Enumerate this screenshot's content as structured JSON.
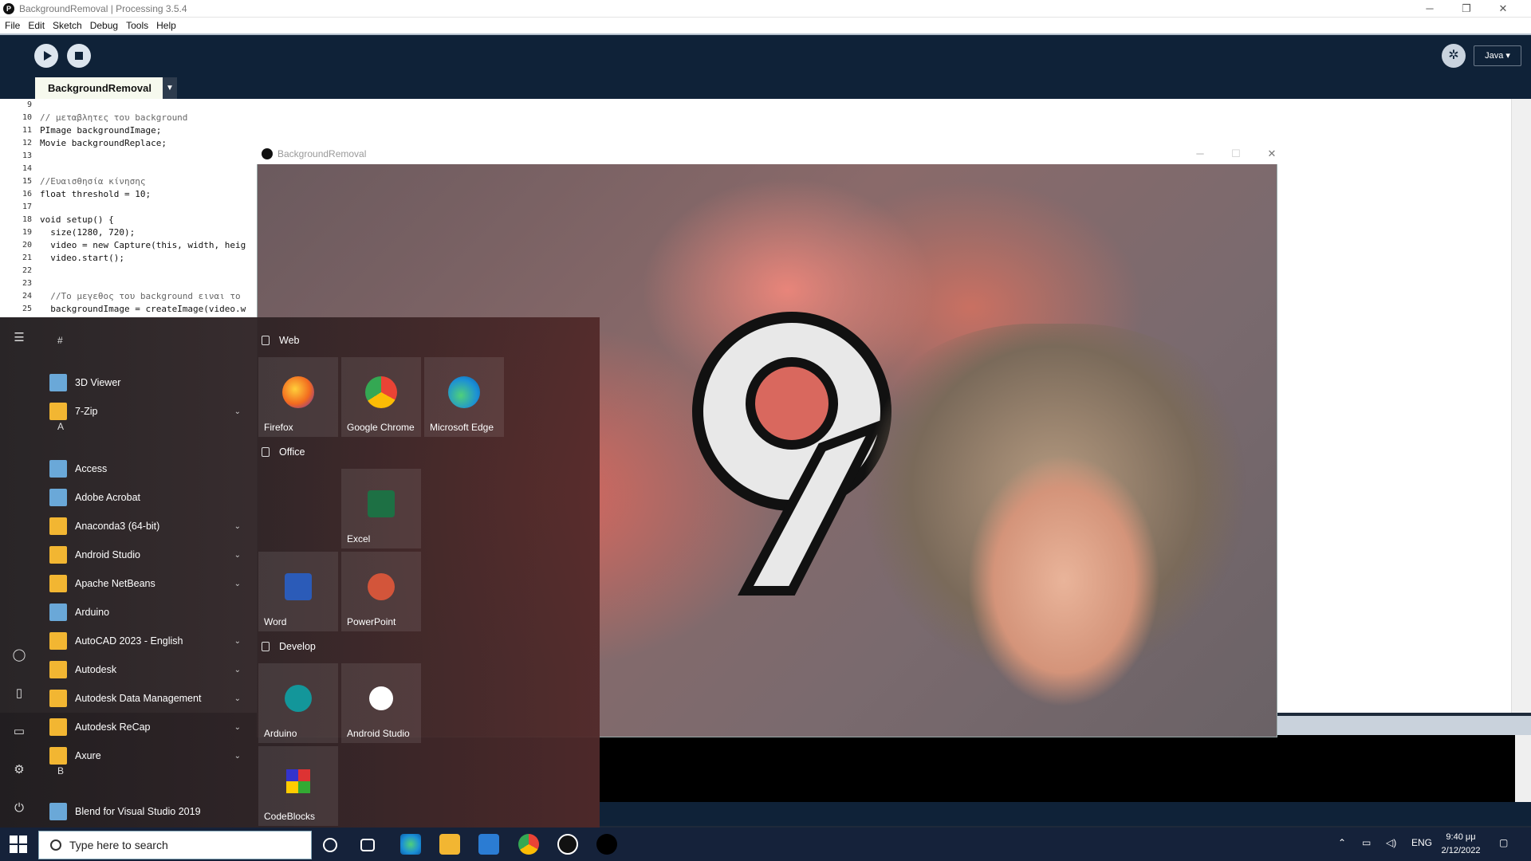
{
  "ide": {
    "title": "BackgroundRemoval | Processing 3.5.4",
    "menu": [
      "File",
      "Edit",
      "Sketch",
      "Debug",
      "Tools",
      "Help"
    ],
    "tab": "BackgroundRemoval",
    "mode": "Java ▾",
    "code_lines": [
      {
        "n": "9",
        "text": ""
      },
      {
        "n": "10",
        "text": "// μεταβλητες του background"
      },
      {
        "n": "11",
        "text": "PImage backgroundImage;"
      },
      {
        "n": "12",
        "text": "Movie backgroundReplace;"
      },
      {
        "n": "13",
        "text": ""
      },
      {
        "n": "14",
        "text": ""
      },
      {
        "n": "15",
        "text": "//Ευαισθησία κίνησης"
      },
      {
        "n": "16",
        "text": "float threshold = 10;"
      },
      {
        "n": "17",
        "text": ""
      },
      {
        "n": "18",
        "text": "void setup() {"
      },
      {
        "n": "19",
        "text": "  size(1280, 720);"
      },
      {
        "n": "20",
        "text": "  video = new Capture(this, width, heig"
      },
      {
        "n": "21",
        "text": "  video.start();"
      },
      {
        "n": "22",
        "text": ""
      },
      {
        "n": "23",
        "text": ""
      },
      {
        "n": "24",
        "text": "  //Το μεγεθος του background ειναι το"
      },
      {
        "n": "25",
        "text": "  backgroundImage = createImage(video.w"
      }
    ]
  },
  "sketch": {
    "title": "BackgroundRemoval"
  },
  "start_menu": {
    "section_hash": "#",
    "letter_a": "A",
    "letter_b": "B",
    "apps": [
      {
        "label": "3D Viewer",
        "folder": false
      },
      {
        "label": "7-Zip",
        "folder": true
      },
      {
        "label": "Access",
        "folder": false
      },
      {
        "label": "Adobe Acrobat",
        "folder": false
      },
      {
        "label": "Anaconda3 (64-bit)",
        "folder": true
      },
      {
        "label": "Android Studio",
        "folder": true
      },
      {
        "label": "Apache NetBeans",
        "folder": true
      },
      {
        "label": "Arduino",
        "folder": false
      },
      {
        "label": "AutoCAD 2023 - English",
        "folder": true
      },
      {
        "label": "Autodesk",
        "folder": true
      },
      {
        "label": "Autodesk Data Management",
        "folder": true
      },
      {
        "label": "Autodesk ReCap",
        "folder": true
      },
      {
        "label": "Axure",
        "folder": true
      },
      {
        "label": "Blend for Visual Studio 2019",
        "folder": false
      }
    ],
    "groups": {
      "web": "Web",
      "office": "Office",
      "develop": "Develop"
    },
    "tiles": {
      "firefox": "Firefox",
      "chrome": "Google Chrome",
      "edge": "Microsoft Edge",
      "excel": "Excel",
      "word": "Word",
      "powerpoint": "PowerPoint",
      "arduino": "Arduino",
      "android_studio": "Android Studio",
      "codeblocks": "CodeBlocks"
    }
  },
  "taskbar": {
    "search_placeholder": "Type here to search",
    "language": "ENG",
    "time": "9:40 μμ",
    "date": "2/12/2022"
  },
  "colors": {
    "ide_toolbar": "#0f2238",
    "taskbar": "#15223a",
    "folder": "#f2b632"
  }
}
